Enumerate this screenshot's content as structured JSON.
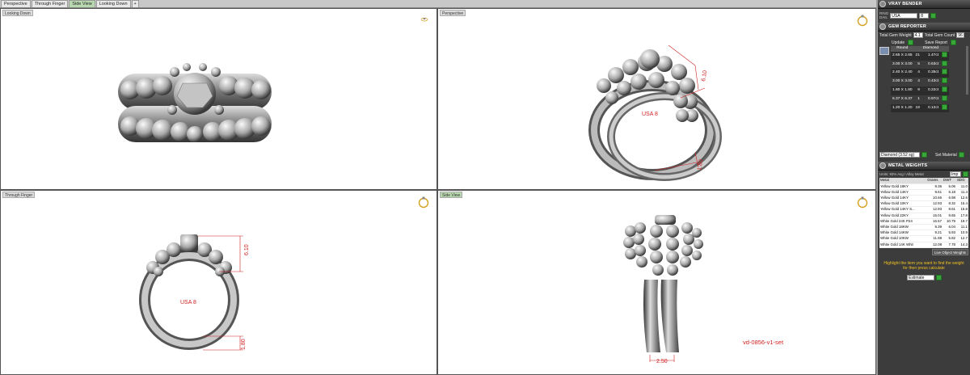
{
  "tabs": [
    "Perspective",
    "Through Finger",
    "Side View",
    "Looking Down",
    "+"
  ],
  "viewports": {
    "top_left": {
      "label": "Looking Down"
    },
    "top_right": {
      "label": "Perspective",
      "dim_top": "6.10",
      "dim_bottom": "1.80",
      "size_text": "USA 8"
    },
    "bottom_left": {
      "label": "Through Finger",
      "dim_top": "6.10",
      "dim_bottom": "1.80",
      "size_text": "USA 8"
    },
    "bottom_right": {
      "label": "Side View",
      "dim_width": "2.50",
      "model_name": "vd-0856-v1-set"
    }
  },
  "panel": {
    "ray_bender": {
      "title": "VRAY BENDER",
      "ring_label": "RING",
      "dail_label": "DAIL",
      "region": "USA",
      "size": "8"
    },
    "gem_reporter": {
      "title": "GEM REPORTER",
      "total_weight_label": "Total Gem Weight",
      "total_weight_value": "4.1",
      "total_count_label": "Total Gem Count",
      "total_count_value": "96",
      "update_label": "Update",
      "save_label": "Save Report",
      "headers": [
        "Round",
        "",
        "Diamond"
      ],
      "rows": [
        [
          "2.65 X 2.65",
          "21",
          "1.47ct"
        ],
        [
          "3.00 X 3.00",
          "5",
          "0.63ct"
        ],
        [
          "2.40 X 2.40",
          "4",
          "0.35ct"
        ],
        [
          "3.00 X 3.00",
          "4",
          "0.43ct"
        ],
        [
          "1.80 X 1.80",
          "9",
          "0.22ct"
        ],
        [
          "6.37 X 6.37",
          "1",
          "0.97ct"
        ],
        [
          "1.20 X 1.20",
          "18",
          "0.12ct"
        ]
      ],
      "material_value": "Diamond (3.52 sg)",
      "set_material_label": "Set Material"
    },
    "metal_weights": {
      "title": "METAL WEIGHTS",
      "units_label": "Units: 93% Avg / Alloy Metal",
      "units_value": "Imp",
      "headers": [
        "Metal",
        "Grams",
        "DWT",
        "SDG"
      ],
      "rows": [
        [
          "Yellow Gold 18KY",
          "9.36",
          "6.06",
          "11.0"
        ],
        [
          "Yellow Gold 14KY",
          "9.61",
          "6.18",
          "11.4"
        ],
        [
          "Yellow Gold 14KY",
          "10.66",
          "6.98",
          "12.6"
        ],
        [
          "Yellow Gold 10KY",
          "12.93",
          "8.32",
          "15.4"
        ],
        [
          "Yellow Gold 14KY S...",
          "12.93",
          "8.61",
          "15.8"
        ],
        [
          "Yellow Gold 22KY",
          "15.01",
          "9.65",
          "17.8"
        ],
        [
          "White Gold 24K P24",
          "16.57",
          "10.79",
          "19.7"
        ],
        [
          "White Gold 18KW",
          "9.39",
          "6.04",
          "11.1"
        ],
        [
          "White Gold 14KW",
          "9.21",
          "5.93",
          "10.9"
        ],
        [
          "White Gold 10KW",
          "11.98",
          "5.82",
          "12.7"
        ],
        [
          "White Gold 14K Whit",
          "12.08",
          "7.78",
          "14.3"
        ]
      ],
      "object_weight_label": "Live Object Weights",
      "hint": "Highlight the item you want to find the weight for then press calculate",
      "calc_value": "Estimate"
    }
  }
}
